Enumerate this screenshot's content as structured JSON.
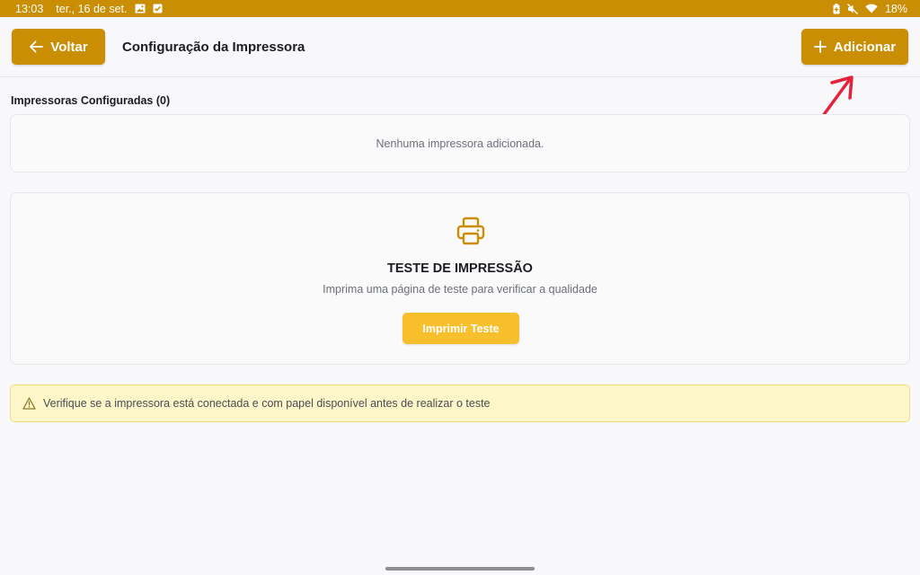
{
  "status_bar": {
    "time": "13:03",
    "date": "ter., 16 de set.",
    "battery": "18%",
    "icons": [
      "image-icon",
      "check-icon",
      "battery-saver-icon",
      "mute-icon",
      "wifi-icon"
    ]
  },
  "header": {
    "back_label": "Voltar",
    "title": "Configuração da Impressora",
    "add_label": "Adicionar"
  },
  "printers": {
    "section_label": "Impressoras Configuradas (0)",
    "empty_text": "Nenhuma impressora adicionada."
  },
  "test": {
    "icon": "printer-icon",
    "title": "TESTE DE IMPRESSÃO",
    "subtitle": "Imprima uma página de teste para verificar a qualidade",
    "button_label": "Imprimir Teste"
  },
  "warning": {
    "icon": "warning-icon",
    "text": "Verifique se a impressora está conectada e com papel disponível antes de realizar o teste"
  },
  "colors": {
    "brand": "#c98e04",
    "test_button": "#f8bf2c",
    "warning_bg": "#fdf6c9",
    "annotation": "#e2233b"
  }
}
